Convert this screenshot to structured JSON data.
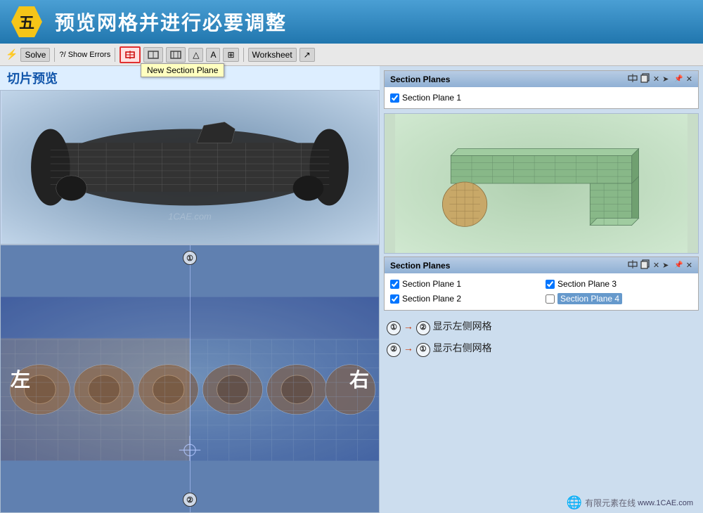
{
  "header": {
    "badge": "五",
    "title": "预览网格并进行必要调整"
  },
  "toolbar": {
    "solve_label": "Solve",
    "show_errors_label": "?/ Show Errors",
    "worksheet_label": "Worksheet",
    "new_section_plane_tooltip": "New Section Plane"
  },
  "labels": {
    "slice_preview": "切片预览"
  },
  "section_planes_panel_top": {
    "title": "Section Planes",
    "plane1": "Section Plane 1"
  },
  "section_planes_panel_bottom": {
    "title": "Section Planes",
    "plane1": "Section Plane 1",
    "plane2": "Section Plane 2",
    "plane3": "Section Plane 3",
    "plane4": "Section Plane 4"
  },
  "info": {
    "line1_circle1": "①",
    "line1_arrow": "→",
    "line1_circle2": "②",
    "line1_text": "  显示左侧网格",
    "line2_circle1": "②",
    "line2_arrow": "→",
    "line2_circle2": "①",
    "line2_text": "  显示右侧网格"
  },
  "overlay": {
    "left": "左",
    "right": "右",
    "num_top": "①",
    "num_bottom": "②"
  },
  "watermark": "1CAE.com",
  "logo": {
    "text": "有限元素在线",
    "url_text": "www.1CAE.com"
  }
}
